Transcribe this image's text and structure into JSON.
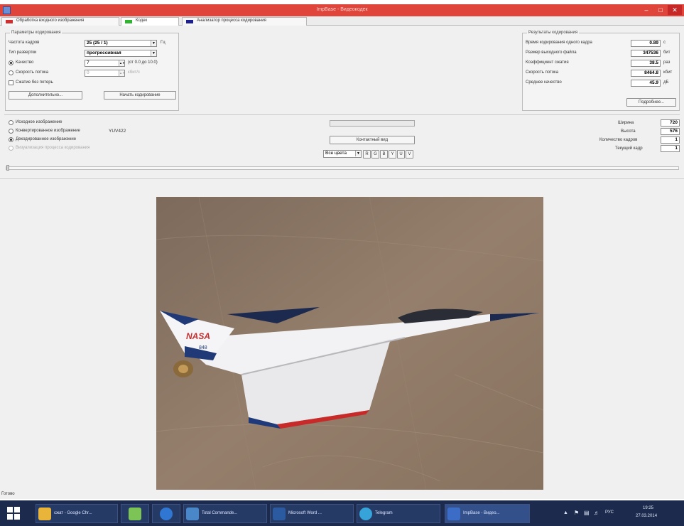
{
  "window": {
    "title": "ImpBase - Видеокодек"
  },
  "tabs": [
    {
      "label": "Обработка входного изображения",
      "color": "#d12f2f"
    },
    {
      "label": "Кодек",
      "color": "#2fb52f"
    },
    {
      "label": "Анализатор процесса кодирования",
      "color": "#1b1f8f"
    }
  ],
  "params": {
    "legend": "Параметры кодирования",
    "frame_rate_label": "Частота кадров",
    "frame_rate_value": "25 (25 / 1)",
    "frame_rate_unit": "Гц",
    "scan_label": "Тип развертки",
    "scan_value": "прогрессивная",
    "quality_label": "Качество",
    "quality_value": "7",
    "quality_hint": "(от 0.0 до 10.0)",
    "bitrate_label": "Скорость потока",
    "bitrate_value": "0",
    "bitrate_unit": "кбит/с",
    "lossless_label": "Сжатие без потерь",
    "advanced_button": "Дополнительно...",
    "start_button": "Начать кодирование"
  },
  "results": {
    "legend": "Результаты кодирования",
    "rows": [
      {
        "label": "Время кодирования одного кадра",
        "value": "0.89",
        "unit": "с"
      },
      {
        "label": "Размер выходного файла",
        "value": "347536",
        "unit": "бит"
      },
      {
        "label": "Коэффициент сжатия",
        "value": "38.5",
        "unit": "раз"
      },
      {
        "label": "Скорость потока",
        "value": "8464.8",
        "unit": "кбит"
      },
      {
        "label": "Среднее качество",
        "value": "45.9",
        "unit": "дБ"
      }
    ],
    "details_button": "Подробнее..."
  },
  "view": {
    "options": [
      {
        "label": "Исходное изображение",
        "selected": false
      },
      {
        "label": "Конвертированное изображение",
        "selected": false
      },
      {
        "label": "Декодированное изображение",
        "selected": true
      },
      {
        "label": "Визуализация процесса кодирования",
        "selected": false
      }
    ],
    "format_value": "YUV422",
    "progress": 0.0,
    "contact_button": "Контактный вид",
    "layer_select": "Все цвета",
    "channel_buttons": [
      "R",
      "G",
      "B",
      "Y",
      "U",
      "V"
    ]
  },
  "info": {
    "rows": [
      {
        "label": "Ширина",
        "value": "720"
      },
      {
        "label": "Высота",
        "value": "576"
      },
      {
        "label": "Количество кадров",
        "value": "1"
      },
      {
        "label": "Текущий кадр",
        "value": "1"
      }
    ]
  },
  "image": {
    "tail_text": "NASA",
    "tail_number": "848"
  },
  "status": {
    "text": "Готово"
  },
  "taskbar": {
    "items": [
      {
        "label": "сжат - Google Chr...",
        "color": "#e8b43a"
      },
      {
        "label": "",
        "color": "#7cc456"
      },
      {
        "label": "",
        "color": "#2f77d3"
      },
      {
        "label": "Total Commande...",
        "color": "#4a87c8"
      },
      {
        "label": "Microsoft Word ...",
        "color": "#2c5aa0"
      },
      {
        "label": "Telegram",
        "color": "#36a3d9"
      },
      {
        "label": "ImpBase - Видео...",
        "color": "#3b6cc6"
      }
    ],
    "lang": "РУС",
    "time": "19:25",
    "date": "27.03.2014"
  }
}
